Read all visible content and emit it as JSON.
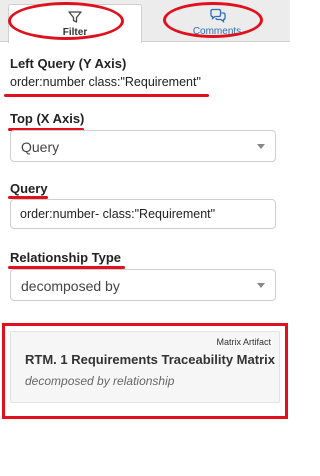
{
  "tabs": [
    {
      "label": "Filter",
      "icon": "filter-icon"
    },
    {
      "label": "Comments",
      "icon": "comments-icon"
    }
  ],
  "left_query": {
    "title": "Left Query (Y Axis)",
    "value": "order:number class:\"Requirement\""
  },
  "top": {
    "title": "Top (X Axis)",
    "selected": "Query"
  },
  "query": {
    "title": "Query",
    "value": "order:number- class:\"Requirement\""
  },
  "relationship": {
    "title": "Relationship Type",
    "selected": "decomposed by"
  },
  "artifact_card": {
    "type_label": "Matrix Artifact",
    "title": "RTM. 1 Requirements Traceability Matrix",
    "subtitle": "decomposed by relationship"
  },
  "colors": {
    "annotation_red": "#e0101c",
    "link_blue": "#2f6fb5"
  }
}
